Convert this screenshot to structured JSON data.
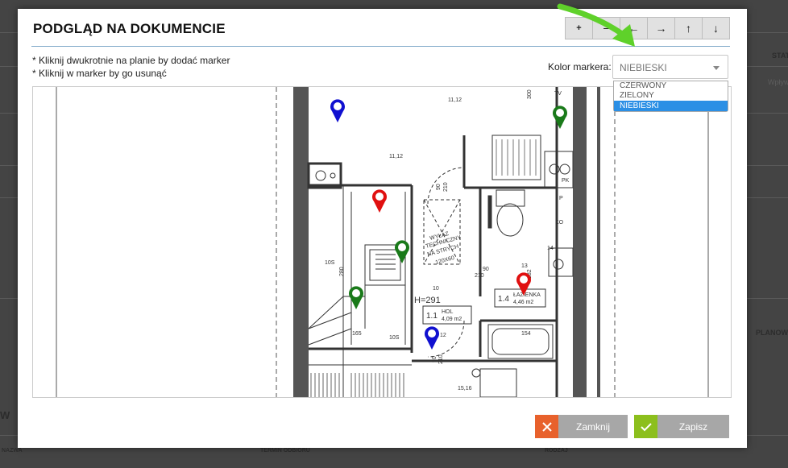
{
  "modal": {
    "title": "PODGLĄD NA DOKUMENCIE",
    "toolbar": [
      "+",
      "−",
      "←",
      "→",
      "↑",
      "↓"
    ],
    "hints": [
      "* Kliknij dwukrotnie na planie by dodać marker",
      "* Kliknij w marker by go usunąć"
    ],
    "color_label": "Kolor markera:",
    "color_select": {
      "value": "NIEBIESKI",
      "options": [
        "CZERWONY",
        "ZIELONY",
        "NIEBIESKI"
      ],
      "selected_index": 2
    },
    "buttons": {
      "close_label": "Zamknij",
      "save_label": "Zapisz"
    }
  },
  "plan": {
    "labels": {
      "l1": "11,12",
      "l2": "11,12",
      "l3": "300",
      "l4": "TV",
      "l5": "90",
      "l6": "210",
      "l7": "PK",
      "l8": "P",
      "l9": "KO",
      "l10": "WYŁAZ",
      "l11": "TECHNICZNY",
      "l12": "NA STRYCH",
      "l13": "120X60",
      "l14": "14",
      "l15": "10S",
      "l16": "280",
      "l17": "90",
      "l18": "210",
      "l19": "13",
      "l20": "282",
      "l21": "10",
      "l22": "H=291",
      "l23": "1.4",
      "l24": "ŁAZIENKA",
      "l25": "4,46 m2",
      "l26": "1.1",
      "l27": "HOL",
      "l28": "4,09 m2",
      "l29": "165",
      "l30": "10S",
      "l31": "12",
      "l32": "154",
      "l33": "90",
      "l34": "210",
      "l35": "15,16"
    },
    "markers": [
      {
        "color": "#1010d0"
      },
      {
        "color": "#e01010"
      },
      {
        "color": "#1a7a1a"
      },
      {
        "color": "#1a7a1a"
      },
      {
        "color": "#1a7a1a"
      },
      {
        "color": "#e01010"
      },
      {
        "color": "#1010d0"
      }
    ]
  },
  "background": {
    "stat": "STAT",
    "wplyw": "Wpływ",
    "planowa": "PLANOWA",
    "w": "W",
    "nazwa": "NAZWA",
    "termin": "TERMIN ODBIORU",
    "rodzaj": "RODZAJ"
  },
  "colors": {
    "accent": "#2b8fe5",
    "close": "#e8612c",
    "save": "#8cbf1d",
    "arrow": "#5fd12a"
  }
}
